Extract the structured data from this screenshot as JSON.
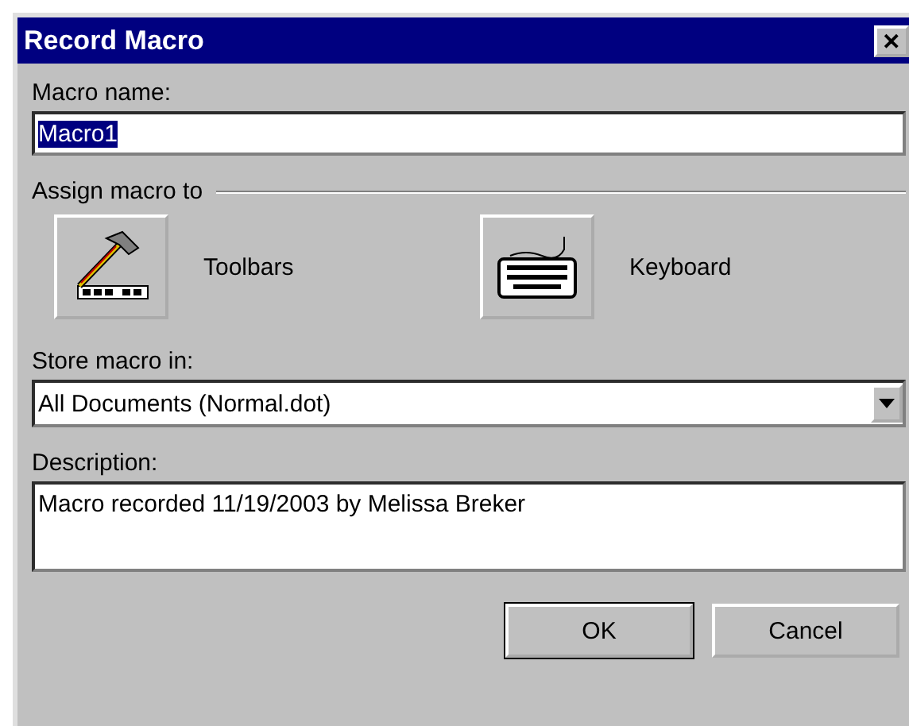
{
  "window": {
    "title": "Record Macro",
    "close_label": "✕"
  },
  "macro_name": {
    "label": "Macro name:",
    "value": "Macro1",
    "text_selected": true
  },
  "assign": {
    "label": "Assign macro to",
    "targets": [
      {
        "kind": "toolbars",
        "label": "Toolbars"
      },
      {
        "kind": "keyboard",
        "label": "Keyboard"
      }
    ]
  },
  "store": {
    "label": "Store macro in:",
    "value": "All Documents (Normal.dot)"
  },
  "description": {
    "label": "Description:",
    "value": "Macro recorded 11/19/2003 by Melissa Breker"
  },
  "buttons": [
    {
      "label": "OK",
      "default": true
    },
    {
      "label": "Cancel",
      "default": false
    }
  ]
}
